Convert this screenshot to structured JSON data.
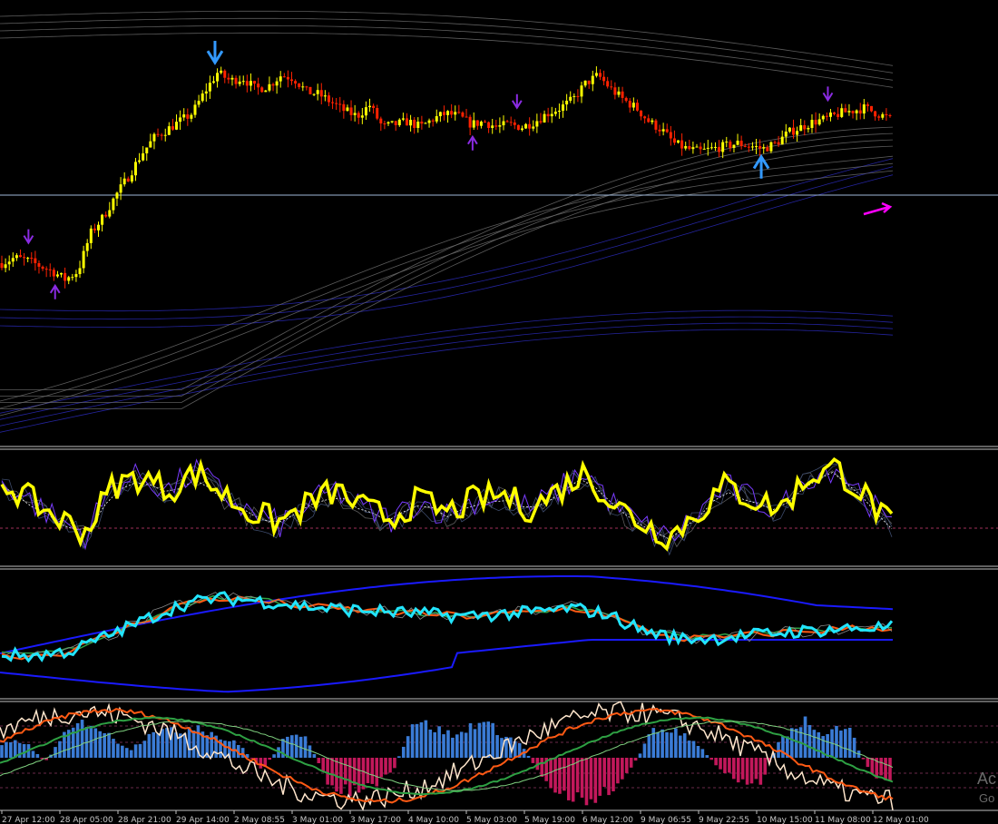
{
  "colors": {
    "background": "#000000",
    "bull": "#ffff00",
    "bear": "#ff2200",
    "price_line": "#9fb8d8",
    "envelope_blue": "#2a2ab8",
    "envelope_gray": "#6b6b6b",
    "arrow_up": "#8a2be2",
    "arrow_big": "#3399ff",
    "arrow_pink": "#ff00ff",
    "osc_yellow": "#ffff00",
    "osc_cyan": "#22e5ff",
    "hist_pos": "#3a7bd5",
    "hist_neg": "#c2185b",
    "line_orange": "#ff5a14",
    "line_green": "#2ea043",
    "line_white": "#ffe6cc"
  },
  "x_axis": {
    "labels": [
      "27 Apr 12:00",
      "28 Apr 05:00",
      "28 Apr 21:00",
      "29 Apr 14:00",
      "2 May 08:55",
      "3 May 01:00",
      "3 May 17:00",
      "4 May 10:00",
      "5 May 03:00",
      "5 May 19:00",
      "6 May 12:00",
      "9 May 06:55",
      "9 May 22:55",
      "10 May 15:00",
      "11 May 08:00",
      "12 May 01:00"
    ]
  },
  "watermark": {
    "line1": "Ac",
    "line2": "Go"
  },
  "chart_data": [
    {
      "type": "candlestick",
      "pane": "price",
      "x_labels": [
        "27 Apr 12:00",
        "28 Apr 05:00",
        "28 Apr 21:00",
        "29 Apr 14:00",
        "2 May 08:55",
        "3 May 01:00",
        "3 May 17:00",
        "4 May 10:00",
        "5 May 03:00",
        "5 May 19:00",
        "6 May 12:00",
        "9 May 06:55",
        "9 May 22:55",
        "10 May 15:00",
        "11 May 08:00",
        "12 May 01:00"
      ],
      "close_path": [
        0.3,
        0.32,
        0.31,
        0.29,
        0.27,
        0.24,
        0.27,
        0.41,
        0.47,
        0.55,
        0.62,
        0.7,
        0.76,
        0.79,
        0.82,
        0.85,
        0.93,
        1.0,
        0.97,
        0.98,
        0.94,
        0.95,
        0.99,
        0.98,
        0.93,
        0.92,
        0.89,
        0.86,
        0.84,
        0.88,
        0.8,
        0.81,
        0.82,
        0.8,
        0.83,
        0.85,
        0.84,
        0.81,
        0.82,
        0.8,
        0.81,
        0.8,
        0.82,
        0.85,
        0.87,
        0.9,
        0.96,
        0.99,
        0.94,
        0.9,
        0.87,
        0.82,
        0.79,
        0.74,
        0.72,
        0.71,
        0.72,
        0.73,
        0.74,
        0.73,
        0.72,
        0.74,
        0.78,
        0.8,
        0.82,
        0.83,
        0.85,
        0.86,
        0.87,
        0.85,
        0.83
      ],
      "markers": [
        {
          "kind": "down-arrow",
          "color": "arrow_big",
          "at": 0.24
        },
        {
          "kind": "down-arrow",
          "color": "arrow_up",
          "at": 0.58
        },
        {
          "kind": "down-arrow",
          "color": "arrow_up",
          "at": 0.93
        },
        {
          "kind": "down-arrow",
          "color": "arrow_up",
          "at": 0.03
        },
        {
          "kind": "up-arrow",
          "color": "arrow_up",
          "at": 0.06
        },
        {
          "kind": "up-arrow",
          "color": "arrow_up",
          "at": 0.53
        },
        {
          "kind": "up-arrow",
          "color": "arrow_big",
          "at": 0.855
        }
      ]
    },
    {
      "type": "line",
      "pane": "oscillator-1",
      "series": [
        {
          "values": [
            0.75,
            0.55,
            0.35,
            0.2,
            0.7,
            0.8,
            0.65,
            0.85,
            0.6,
            0.4,
            0.3,
            0.5,
            0.65,
            0.45,
            0.35,
            0.55,
            0.4,
            0.55,
            0.6,
            0.45,
            0.65,
            0.85,
            0.5,
            0.3,
            0.15,
            0.4,
            0.7,
            0.55,
            0.45,
            0.8,
            0.9,
            0.6,
            0.25
          ]
        }
      ]
    },
    {
      "type": "line",
      "pane": "oscillator-2",
      "series": [
        {
          "values": [
            0.25,
            0.25,
            0.3,
            0.45,
            0.6,
            0.75,
            0.82,
            0.8,
            0.76,
            0.72,
            0.7,
            0.68,
            0.66,
            0.64,
            0.66,
            0.68,
            0.72,
            0.66,
            0.5,
            0.42,
            0.42,
            0.45,
            0.48,
            0.5,
            0.52,
            0.53
          ]
        }
      ]
    },
    {
      "type": "bar",
      "pane": "histogram",
      "values": [
        0.3,
        0.4,
        -0.1,
        0.6,
        0.9,
        0.5,
        0.2,
        0.7,
        0.6,
        0.8,
        0.5,
        0.3,
        -0.3,
        0.4,
        0.6,
        -0.6,
        -0.8,
        -0.7,
        -0.4,
        0.9,
        0.7,
        0.5,
        0.9,
        0.6,
        0.3,
        -0.5,
        -0.9,
        -1.0,
        -0.8,
        -0.3,
        0.6,
        0.7,
        0.4,
        -0.2,
        -0.5,
        -0.6,
        0.5,
        0.9,
        0.6,
        0.8,
        -0.3,
        -0.6
      ]
    }
  ]
}
